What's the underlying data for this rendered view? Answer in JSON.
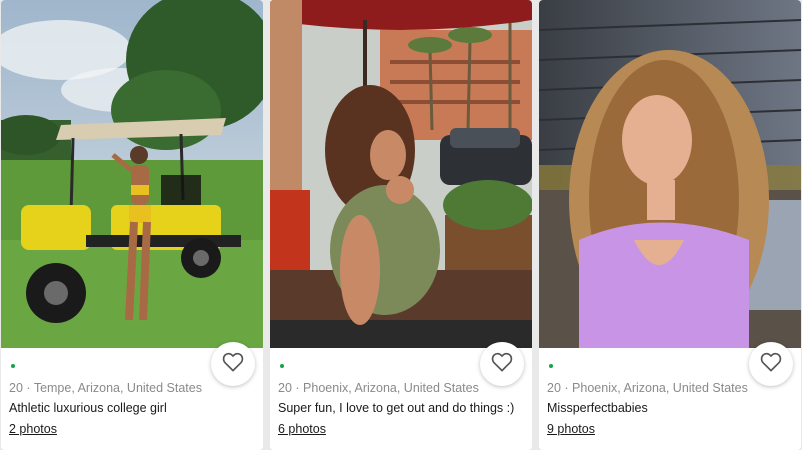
{
  "profiles": [
    {
      "age": "20",
      "separator": "·",
      "location": "Tempe, Arizona, United States",
      "headline": "Athletic luxurious college girl",
      "photos_link": "2 photos",
      "photo_icon": "profile-photo-golf-cart",
      "online_color": "#17a34a"
    },
    {
      "age": "20",
      "separator": "·",
      "location": "Phoenix, Arizona, United States",
      "headline": "Super fun, I love to get out and do things :)",
      "photos_link": "6 photos",
      "photo_icon": "profile-photo-patio-umbrella",
      "online_color": "#17a34a"
    },
    {
      "age": "20",
      "separator": "·",
      "location": "Phoenix, Arizona, United States",
      "headline": "Missperfectbabies",
      "photos_link": "9 photos",
      "photo_icon": "profile-photo-sunlit-portrait",
      "online_color": "#17a34a"
    }
  ],
  "favorite_icon": "heart-outline-icon"
}
